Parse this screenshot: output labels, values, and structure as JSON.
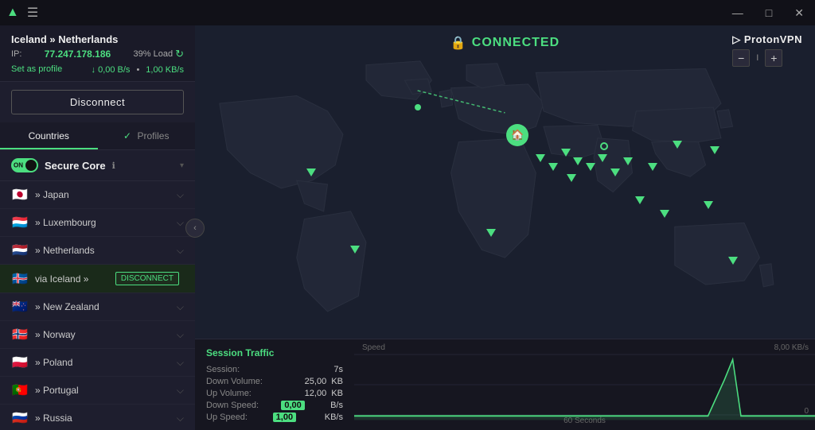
{
  "titlebar": {
    "logo": "▲",
    "hamburger": "☰",
    "minimize": "—",
    "maximize": "□",
    "close": "✕"
  },
  "connection": {
    "route": "Iceland » Netherlands",
    "ip_label": "IP:",
    "ip": "77.247.178.186",
    "load_label": "39% Load",
    "profile_link": "Set as profile",
    "down_speed": "↓ 0,00 B/s",
    "up_speed": "1,00 KB/s",
    "disconnect_btn": "Disconnect"
  },
  "tabs": {
    "countries": "Countries",
    "profiles": "Profiles"
  },
  "secure_core": {
    "toggle_label": "ON",
    "label": "Secure Core",
    "info": "ℹ"
  },
  "countries": [
    {
      "flag": "🇯🇵",
      "name": "» Japan",
      "connected": false
    },
    {
      "flag": "🇱🇺",
      "name": "» Luxembourg",
      "connected": false
    },
    {
      "flag": "🇳🇱",
      "name": "» Netherlands",
      "connected": false
    },
    {
      "flag": "🇮🇸",
      "name": "via Iceland »",
      "connected": true,
      "disconnect": "DISCONNECT"
    },
    {
      "flag": "🇳🇿",
      "name": "» New Zealand",
      "connected": false
    },
    {
      "flag": "🇳🇴",
      "name": "» Norway",
      "connected": false
    },
    {
      "flag": "🇵🇱",
      "name": "» Poland",
      "connected": false
    },
    {
      "flag": "🇵🇹",
      "name": "» Portugal",
      "connected": false
    },
    {
      "flag": "🇷🇺",
      "name": "» Russia",
      "connected": false
    }
  ],
  "status": {
    "connected": "CONNECTED",
    "lock_icon": "🔒"
  },
  "branding": {
    "logo_icon": "▷",
    "name": "ProtonVPN",
    "zoom_minus": "−",
    "zoom_value": "I",
    "zoom_plus": "+"
  },
  "session": {
    "title": "Session Traffic",
    "rows": [
      {
        "label": "Session:",
        "value": "7s",
        "highlight": false
      },
      {
        "label": "Down Volume:",
        "value": "25,00",
        "unit": "KB",
        "highlight": false
      },
      {
        "label": "Up Volume:",
        "value": "12,00",
        "unit": "KB",
        "highlight": false
      },
      {
        "label": "Down Speed:",
        "value": "0,00",
        "unit": "B/s",
        "highlight": true
      },
      {
        "label": "Up Speed:",
        "value": "1,00",
        "unit": "KB/s",
        "highlight": true
      }
    ],
    "chart_speed_label": "Speed",
    "chart_8kb_label": "8,00 KB/s",
    "chart_0_label": "0",
    "chart_60s_label": "60 Seconds"
  }
}
